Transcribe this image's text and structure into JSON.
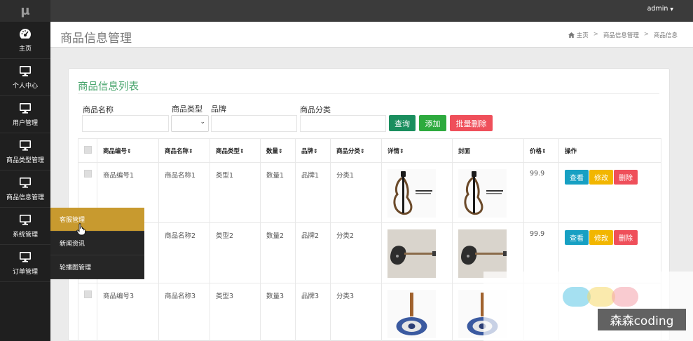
{
  "logo": "μ",
  "sidebar": {
    "items": [
      {
        "label": "主页",
        "icon": "dashboard-icon"
      },
      {
        "label": "个人中心",
        "icon": "monitor-icon"
      },
      {
        "label": "用户管理",
        "icon": "monitor-icon"
      },
      {
        "label": "商品类型管理",
        "icon": "monitor-icon"
      },
      {
        "label": "商品信息管理",
        "icon": "monitor-icon"
      },
      {
        "label": "系统管理",
        "icon": "monitor-icon"
      },
      {
        "label": "订单管理",
        "icon": "monitor-icon"
      }
    ],
    "flyout": [
      "客服管理",
      "新闻资讯",
      "轮播图管理"
    ]
  },
  "topbar": {
    "user": "admin",
    "caret": "▼"
  },
  "header": {
    "title": "商品信息管理",
    "breadcrumb": [
      "主页",
      "商品信息管理",
      "商品信息"
    ],
    "separator": ">"
  },
  "card": {
    "title": "商品信息列表",
    "filters": {
      "name": "商品名称",
      "type": "商品类型",
      "brand": "品牌",
      "category": "商品分类",
      "select_chevron": "⌄"
    },
    "buttons": {
      "query": "查询",
      "add": "添加",
      "batch_delete": "批量删除"
    }
  },
  "table": {
    "headers": [
      "商品编号",
      "商品名称",
      "商品类型",
      "数量",
      "品牌",
      "商品分类",
      "详情",
      "封面",
      "价格",
      "操作"
    ],
    "sort_icon": "⇕",
    "rows": [
      {
        "code": "商品编号1",
        "name": "商品名称1",
        "type": "类型1",
        "qty": "数量1",
        "brand": "品牌1",
        "category": "分类1",
        "price": "99.9",
        "image": "silent-guitar"
      },
      {
        "code": "",
        "name": "商品名称2",
        "type": "类型2",
        "qty": "数量2",
        "brand": "品牌2",
        "category": "分类2",
        "price": "99.9",
        "image": "electric-guitar"
      },
      {
        "code": "商品编号3",
        "name": "商品名称3",
        "type": "类型3",
        "qty": "数量3",
        "brand": "品牌3",
        "category": "分类3",
        "price": "",
        "image": "patterned-guitar"
      }
    ],
    "actions": {
      "view": "查看",
      "edit": "修改",
      "delete": "删除"
    }
  },
  "watermark": "森森coding",
  "colors": {
    "accent_green": "#47a46b",
    "flyout_active": "#c89a2f",
    "view": "#17a0c3",
    "edit": "#f2b600",
    "delete": "#ef4f5a"
  }
}
